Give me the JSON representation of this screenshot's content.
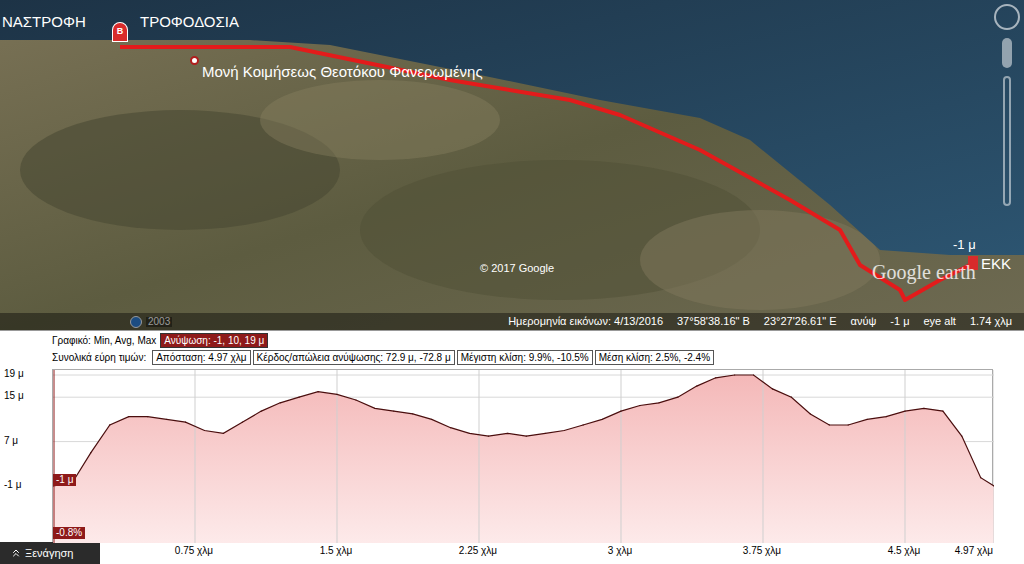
{
  "map": {
    "endpoint_label": "ΝΑΣΤΡΟΦΗ",
    "endpoint_marker": "B",
    "feed_label": "ΤΡΟΦΟΔΟΣΙΑ",
    "monastery_label": "Μονή Κοιμήσεως Θεοτόκου Φανερωμένης",
    "start_elevation": "-1 μ",
    "start_label": "ΕΚΚ",
    "copyright": "© 2017 Google",
    "watermark": "Google earth",
    "history_year": "2003",
    "status": {
      "imagery_date": "Ημερομηνία εικόνων: 4/13/2016",
      "latitude": "37°58'38.16\" Β",
      "longitude": "23°27'26.61\" Ε",
      "elevation_label": "ανύψ",
      "elevation": "-1 μ",
      "eye_label": "eye alt",
      "eye": "1.74 χλμ"
    }
  },
  "profile": {
    "graph_label": "Γραφικό: Min, Avg, Max",
    "graph_value": "Ανύψωση: -1, 10, 19 μ",
    "ranges_label": "Συνολικά εύρη τιμών:",
    "ranges": [
      "Απόσταση: 4.97 χλμ",
      "Κέρδος/απώλεια ανύψωσης: 72.9 μ, -72.8 μ",
      "Μέγιστη κλίση: 9.9%, -10.5%",
      "Μέση κλίση: 2.5%, -2.4%"
    ],
    "y_ticks": [
      {
        "label": "19 μ",
        "value": 19
      },
      {
        "label": "15 μ",
        "value": 15
      },
      {
        "label": "7 μ",
        "value": 7
      },
      {
        "label": "-1 μ",
        "value": -1
      }
    ],
    "x_ticks": [
      {
        "label": "0.75 χλμ",
        "value": 0.75
      },
      {
        "label": "1.5 χλμ",
        "value": 1.5
      },
      {
        "label": "2.25 χλμ",
        "value": 2.25
      },
      {
        "label": "3 χλμ",
        "value": 3
      },
      {
        "label": "3.75 χλμ",
        "value": 3.75
      },
      {
        "label": "4.5 χλμ",
        "value": 4.5
      },
      {
        "label": "4.97 χλμ",
        "value": 4.97
      }
    ],
    "series": {
      "name": "Ανύψωση",
      "distance_max": 4.97,
      "values": [
        -1,
        -0.5,
        5,
        10,
        11.5,
        11.5,
        11,
        10.5,
        9,
        8.5,
        10.5,
        12.5,
        14,
        15,
        16,
        15.5,
        14.5,
        13,
        12.5,
        12,
        11,
        9.5,
        8.5,
        8,
        8.5,
        8,
        8.5,
        9,
        10,
        11,
        12.5,
        13.5,
        14,
        15,
        17,
        18.5,
        19,
        19,
        16.5,
        15,
        12,
        10,
        10,
        11,
        11.5,
        12.5,
        13,
        12.5,
        8,
        0.5,
        -1
      ]
    },
    "cursor": {
      "elevation": "-1 μ",
      "slope": "-0.8%"
    }
  },
  "tour_button": {
    "label": "Ξενάγηση"
  }
}
